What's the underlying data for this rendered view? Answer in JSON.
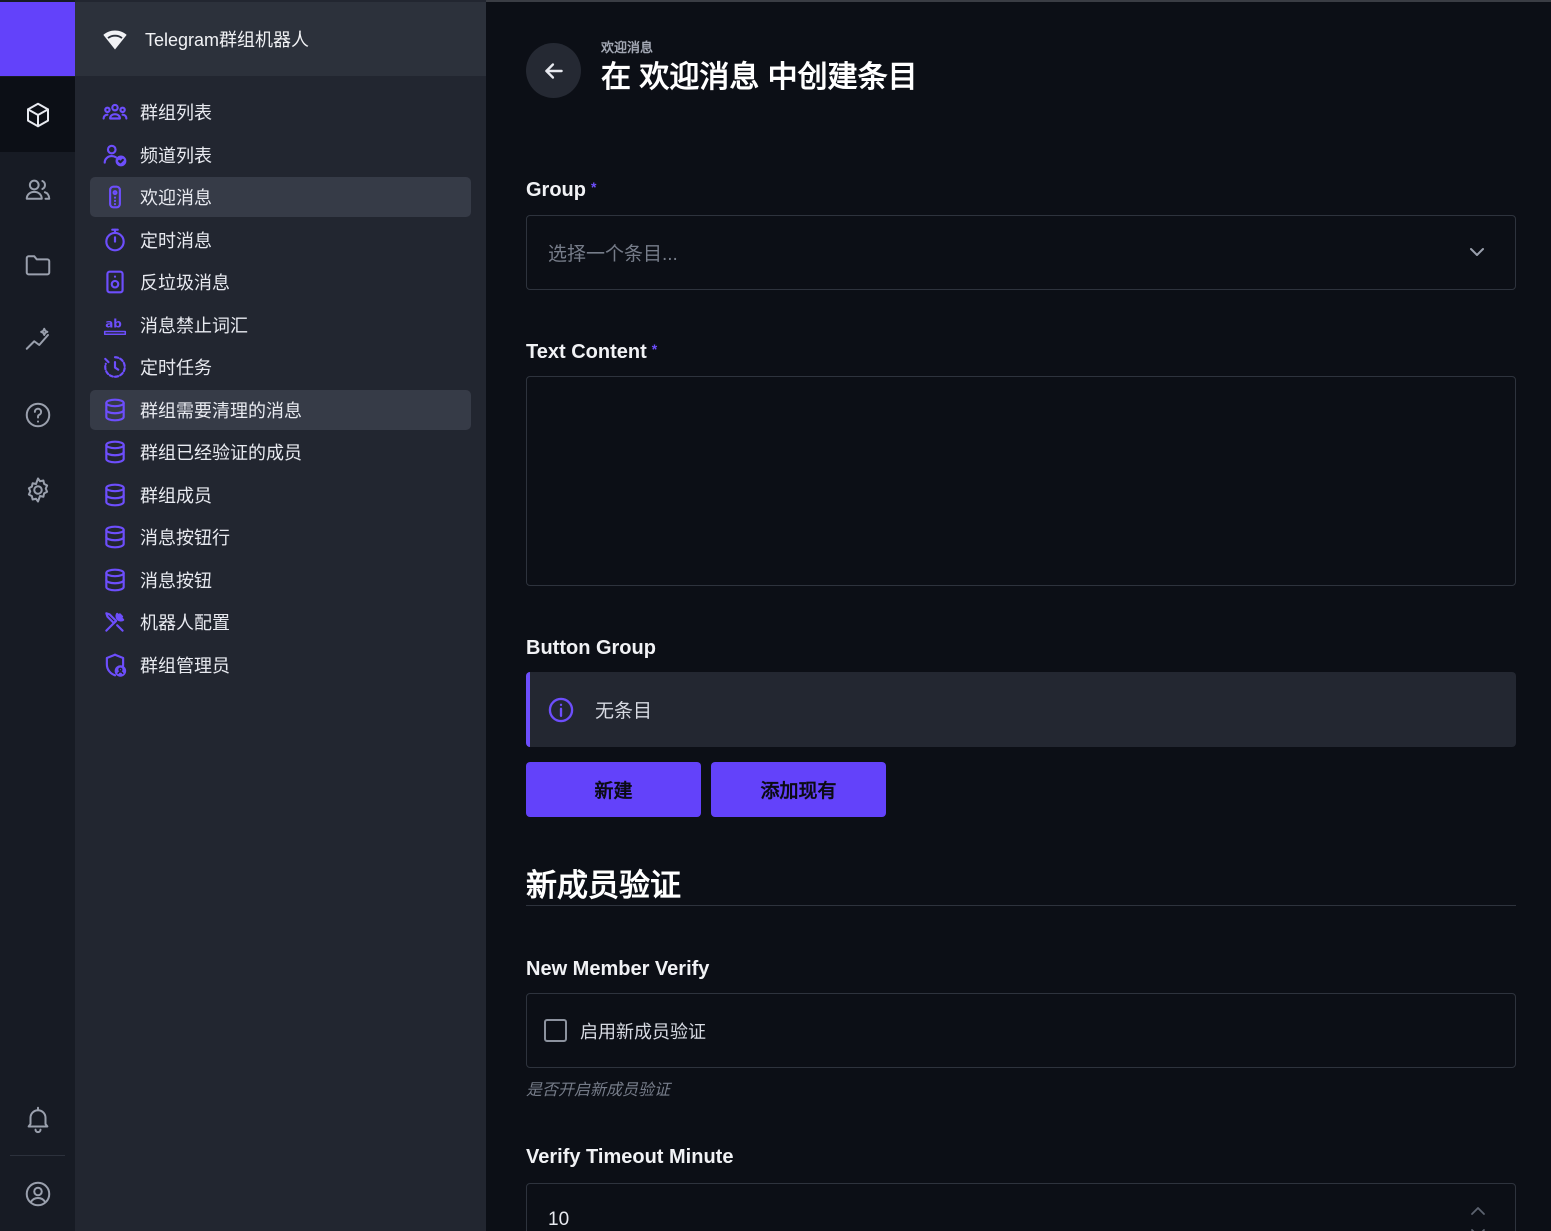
{
  "app": {
    "title": "Telegram群组机器人"
  },
  "sidebar": {
    "items": [
      {
        "label": "群组列表",
        "icon": "users-group-icon"
      },
      {
        "label": "频道列表",
        "icon": "user-check-icon"
      },
      {
        "label": "欢迎消息",
        "icon": "device-remote-icon",
        "active": true
      },
      {
        "label": "定时消息",
        "icon": "stopwatch-icon"
      },
      {
        "label": "反垃圾消息",
        "icon": "speaker-icon"
      },
      {
        "label": "消息禁止词汇",
        "icon": "text-ab-icon"
      },
      {
        "label": "定时任务",
        "icon": "clock-dashed-icon"
      },
      {
        "label": "群组需要清理的消息",
        "icon": "database-icon",
        "highlighted": true
      },
      {
        "label": "群组已经验证的成员",
        "icon": "database-icon"
      },
      {
        "label": "群组成员",
        "icon": "database-icon"
      },
      {
        "label": "消息按钮行",
        "icon": "database-icon"
      },
      {
        "label": "消息按钮",
        "icon": "database-icon"
      },
      {
        "label": "机器人配置",
        "icon": "tools-icon"
      },
      {
        "label": "群组管理员",
        "icon": "shield-user-icon"
      }
    ]
  },
  "header": {
    "breadcrumb": "欢迎消息",
    "title": "在 欢迎消息 中创建条目"
  },
  "form": {
    "group": {
      "label": "Group",
      "required_mark": "*",
      "placeholder": "选择一个条目..."
    },
    "text_content": {
      "label": "Text Content",
      "required_mark": "*"
    },
    "button_group": {
      "label": "Button Group",
      "empty_text": "无条目",
      "new_label": "新建",
      "add_existing_label": "添加现有"
    },
    "section": {
      "title": "新成员验证"
    },
    "new_member_verify": {
      "label": "New Member Verify",
      "checkbox_label": "启用新成员验证",
      "hint": "是否开启新成员验证"
    },
    "verify_timeout": {
      "label": "Verify Timeout Minute",
      "value": "10"
    }
  },
  "colors": {
    "accent": "#6342fa",
    "background": "#0c0f16",
    "sidebar": "#222630",
    "rail": "#171b24"
  }
}
